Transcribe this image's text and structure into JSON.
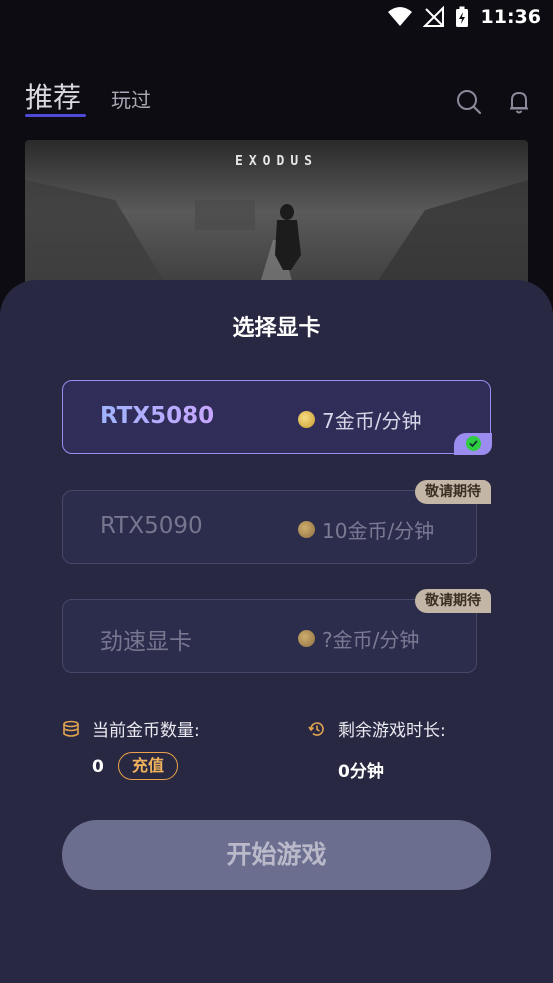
{
  "status_bar": {
    "time": "11:36"
  },
  "nav": {
    "tab_recommend": "推荐",
    "tab_played": "玩过"
  },
  "banner": {
    "title": "EXODUS"
  },
  "sheet": {
    "title": "选择显卡",
    "options": [
      {
        "name": "RTX5080",
        "price": "7金币/分钟",
        "selected": true
      },
      {
        "name": "RTX5090",
        "price": "10金币/分钟",
        "badge": "敬请期待"
      },
      {
        "name": "劲速显卡",
        "price": "?金币/分钟",
        "badge": "敬请期待"
      }
    ],
    "coins_label": "当前金币数量:",
    "coins_value": "0",
    "recharge_label": "充值",
    "time_label": "剩余游戏时长:",
    "time_value": "0分钟",
    "start_label": "开始游戏"
  },
  "colors": {
    "accent": "#9b8df0",
    "sheet_bg": "#282843",
    "gold": "#e9a24a"
  }
}
